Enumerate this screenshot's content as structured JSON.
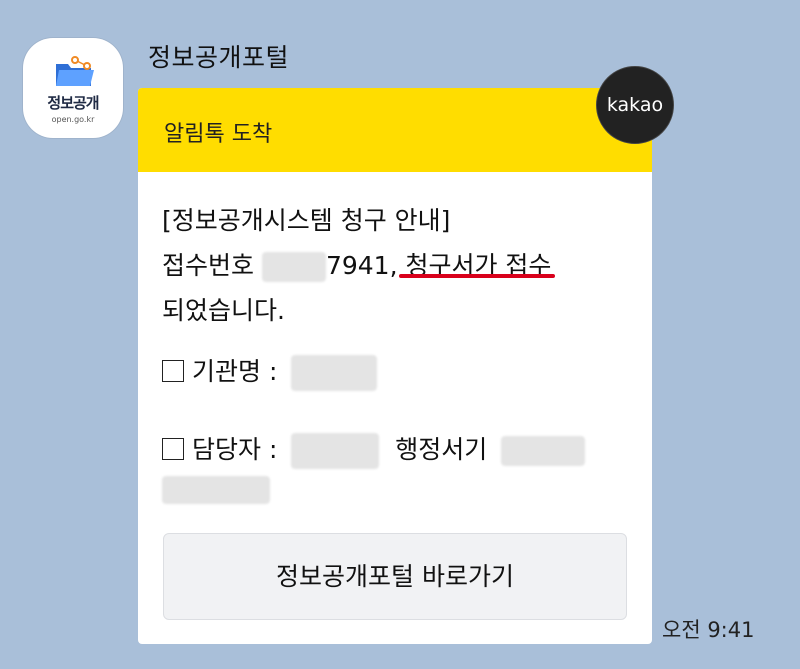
{
  "sender": {
    "name": "정보공개포털",
    "avatar_logo_text": "정보공개",
    "avatar_logo_sub": "open.go.kr"
  },
  "card": {
    "header_title": "알림톡 도착",
    "badge": "kakao",
    "message": {
      "line1": "[정보공개시스템 청구 안내]",
      "line2_prefix": "접수번호 ",
      "receipt_suffix": "7941, ",
      "highlight": "청구서가 접수",
      "line3": "되었습니다."
    },
    "items": [
      {
        "label": "기관명 :"
      },
      {
        "label": "담당자 :",
        "extra": "행정서기"
      }
    ],
    "button_label": "정보공개포털 바로가기"
  },
  "timestamp": "오전 9:41",
  "colors": {
    "background": "#a9bfd9",
    "header_yellow": "#ffdd00",
    "underline_red": "#d9001b",
    "badge_dark": "#222222"
  }
}
